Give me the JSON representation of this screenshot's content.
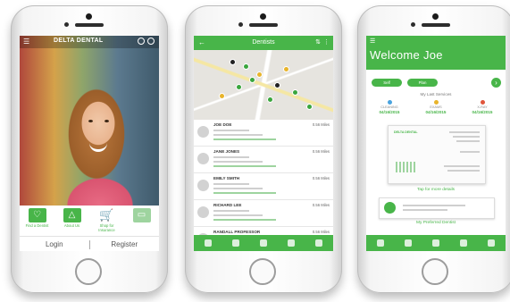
{
  "phone1": {
    "header": {
      "brand": "DELTA DENTAL",
      "menu_icon": "hamburger-icon",
      "icons": [
        "info-icon",
        "help-icon"
      ]
    },
    "tiles": [
      {
        "label": "Find a Dentist",
        "icon": "tooth-icon"
      },
      {
        "label": "About Us",
        "icon": "delta-logo-icon"
      },
      {
        "label": "Shop for Insurance",
        "icon": "cart-icon"
      },
      {
        "label": "",
        "icon": "id-card-icon"
      }
    ],
    "login": "Login",
    "register": "Register"
  },
  "phone2": {
    "header": {
      "title": "Dentists"
    },
    "rows": [
      {
        "name": "JOE DOE",
        "distance": "0.56 Miles"
      },
      {
        "name": "JANE JONES",
        "distance": "0.56 Miles"
      },
      {
        "name": "EMILY SMITH",
        "distance": "0.56 Miles"
      },
      {
        "name": "RICHARD LEE",
        "distance": "0.56 Miles"
      },
      {
        "name": "RANDALL PROFESSOR",
        "distance": "0.56 Miles"
      }
    ],
    "tabs": [
      "map-icon",
      "bookmark-icon",
      "id-card-icon",
      "settings-icon",
      "more-icon"
    ]
  },
  "phone3": {
    "header": {
      "title": "Welcome Joe",
      "menu_icon": "hamburger-icon"
    },
    "toggle_left": "Self",
    "toggle_right": "Plan",
    "section_title": "My Last Services",
    "services": [
      {
        "label": "CLEANING",
        "date": "04/16/2015",
        "color": "#4aa3df"
      },
      {
        "label": "EXAMS",
        "date": "04/16/2015",
        "color": "#e8b42b"
      },
      {
        "label": "X-RAY",
        "date": "04/16/2015",
        "color": "#e0553b"
      }
    ],
    "card_brand": "DELTA DENTAL",
    "tap_text": "Tap for more details",
    "preferred": "My Preferred Dentist",
    "tabs": [
      "home-icon",
      "find-dentist-icon",
      "id-card-icon",
      "settings-icon",
      "more-icon"
    ]
  },
  "colors": {
    "brand_green": "#48b549"
  }
}
